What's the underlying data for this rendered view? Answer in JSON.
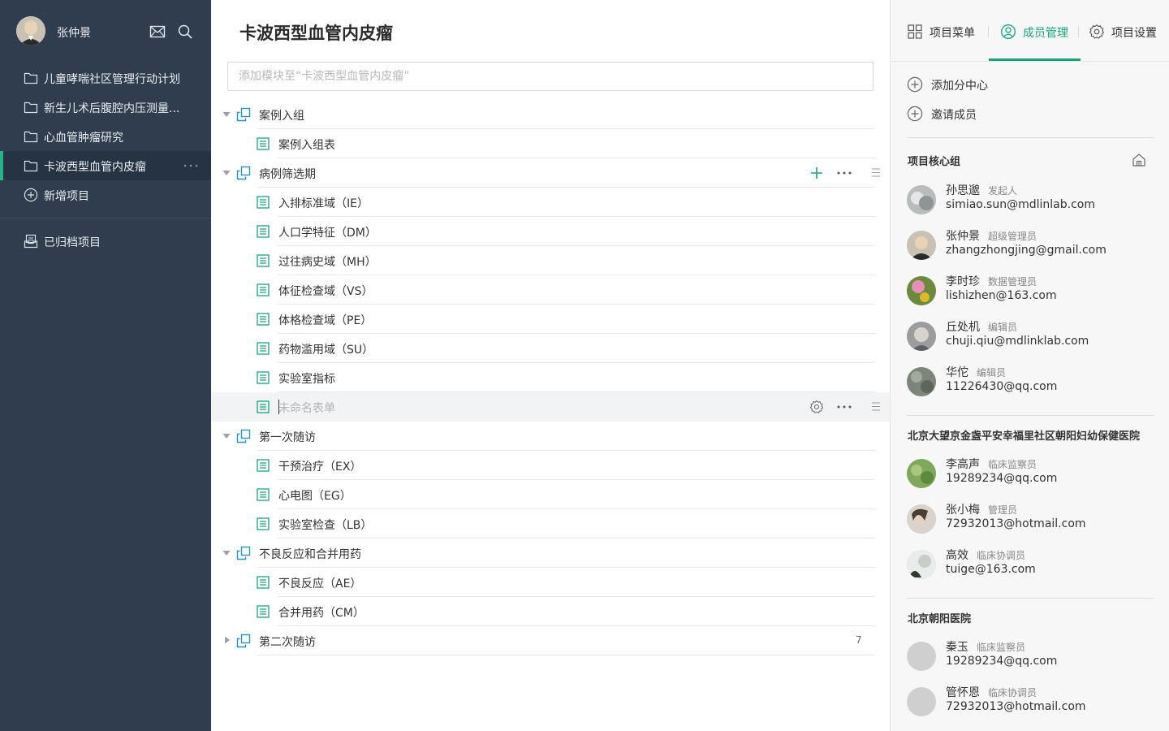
{
  "colors": {
    "sidebar_bg": "#2f3d4f",
    "accent": "#1aa27c",
    "active_item_bg": "#263343"
  },
  "sidebar": {
    "username": "张仲景",
    "icons": [
      "mail-icon",
      "search-icon"
    ],
    "projects": [
      {
        "label": "儿童哮喘社区管理行动计划",
        "icon": "folder-icon"
      },
      {
        "label": "新生儿术后腹腔内压测量...",
        "icon": "folder-icon"
      },
      {
        "label": "心血管肿瘤研究",
        "icon": "folder-icon"
      },
      {
        "label": "卡波西型血管内皮瘤",
        "icon": "folder-icon",
        "active": true
      }
    ],
    "new_project": "新增项目",
    "archived": "已归档项目"
  },
  "main": {
    "title": "卡波西型血管内皮瘤",
    "add_placeholder": "添加模块至“卡波西型血管内皮瘤”",
    "groups": [
      {
        "label": "案例入组",
        "expanded": true,
        "forms": [
          "案例入组表"
        ]
      },
      {
        "label": "病例筛选期",
        "expanded": true,
        "forms": [
          "入排标准域（IE）",
          "人口学特征（DM）",
          "过往病史域（MH）",
          "体征检查域（VS）",
          "体格检查域（PE）",
          "药物滥用域（SU）",
          "实验室指标"
        ],
        "editing_placeholder": "未命名表单"
      },
      {
        "label": "第一次随访",
        "expanded": true,
        "forms": [
          "干预治疗（EX）",
          "心电图（EG）",
          "实验室检查（LB）"
        ]
      },
      {
        "label": "不良反应和合并用药",
        "expanded": true,
        "forms": [
          "不良反应（AE）",
          "合并用药（CM）"
        ]
      },
      {
        "label": "第二次随访",
        "expanded": false,
        "count": "7"
      }
    ]
  },
  "right": {
    "tabs": [
      {
        "label": "项目菜单",
        "icon": "grid-icon"
      },
      {
        "label": "成员管理",
        "icon": "user-icon",
        "active": true
      },
      {
        "label": "项目设置",
        "icon": "gear-icon"
      }
    ],
    "actions": [
      "添加分中心",
      "邀请成员"
    ],
    "groups": [
      {
        "title": "项目核心组",
        "members": [
          {
            "name": "孙思邈",
            "role": "发起人",
            "email": "simiao.sun@mdlinlab.com"
          },
          {
            "name": "张仲景",
            "role": "超级管理员",
            "email": "zhangzhongjing@gmail.com"
          },
          {
            "name": "李时珍",
            "role": "数据管理员",
            "email": "lishizhen@163.com"
          },
          {
            "name": "丘处机",
            "role": "编辑员",
            "email": "chuji.qiu@mdlinklab.com"
          },
          {
            "name": "华佗",
            "role": "编辑员",
            "email": "11226430@qq.com"
          }
        ]
      },
      {
        "title": "北京大望京金盏平安幸福里社区朝阳妇幼保健医院",
        "members": [
          {
            "name": "李高声",
            "role": "临床监察员",
            "email": "19289234@qq.com"
          },
          {
            "name": "张小梅",
            "role": "管理员",
            "email": "72932013@hotmail.com"
          },
          {
            "name": "高效",
            "role": "临床协调员",
            "email": "tuige@163.com"
          }
        ]
      },
      {
        "title": "北京朝阳医院",
        "members": [
          {
            "name": "秦玉",
            "role": "临床监察员",
            "email": "19289234@qq.com"
          },
          {
            "name": "管怀恩",
            "role": "临床协调员",
            "email": "72932013@hotmail.com"
          }
        ]
      }
    ]
  }
}
